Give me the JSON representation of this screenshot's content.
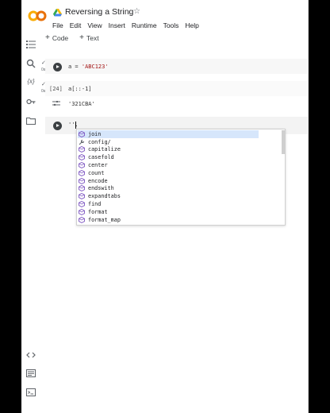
{
  "notebook": {
    "title": "Reversing a String",
    "menu": [
      "File",
      "Edit",
      "View",
      "Insert",
      "Runtime",
      "Tools",
      "Help"
    ],
    "toolbar": {
      "code_label": "Code",
      "text_label": "Text"
    }
  },
  "cells": {
    "cell1": {
      "code_prefix": "a = ",
      "code_string": "'ABC123'",
      "status": "0s"
    },
    "cell2": {
      "exec_count": "[24]",
      "code": "a[::-1]",
      "status": "0s",
      "output": "'321CBA'"
    },
    "cell3": {
      "code": "''."
    }
  },
  "autocomplete": {
    "items": [
      {
        "label": "join",
        "icon": "method-icon",
        "selected": true
      },
      {
        "label": "config/",
        "icon": "wrench-icon",
        "selected": false
      },
      {
        "label": "capitalize",
        "icon": "method-icon",
        "selected": false
      },
      {
        "label": "casefold",
        "icon": "method-icon",
        "selected": false
      },
      {
        "label": "center",
        "icon": "method-icon",
        "selected": false
      },
      {
        "label": "count",
        "icon": "method-icon",
        "selected": false
      },
      {
        "label": "encode",
        "icon": "method-icon",
        "selected": false
      },
      {
        "label": "endswith",
        "icon": "method-icon",
        "selected": false
      },
      {
        "label": "expandtabs",
        "icon": "method-icon",
        "selected": false
      },
      {
        "label": "find",
        "icon": "method-icon",
        "selected": false
      },
      {
        "label": "format",
        "icon": "method-icon",
        "selected": false
      },
      {
        "label": "format_map",
        "icon": "method-icon",
        "selected": false
      }
    ]
  },
  "colors": {
    "accent": "#f9ab00",
    "method_icon": "#7e57c2",
    "selected_bg": "#d6e6fb"
  }
}
